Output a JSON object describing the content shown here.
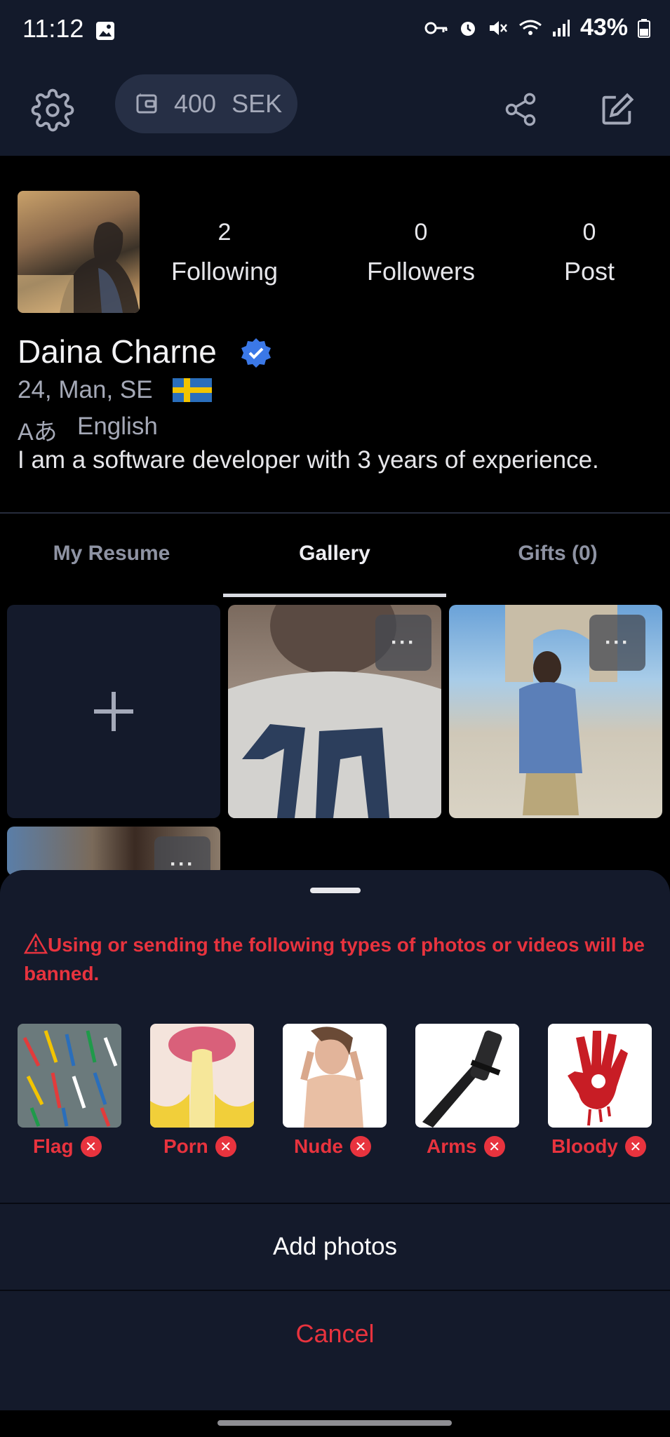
{
  "status": {
    "time": "11:12",
    "battery": "43%"
  },
  "wallet": {
    "amount": "400",
    "currency": "SEK"
  },
  "profile": {
    "name": "Daina Charne",
    "meta": "24, Man, SE",
    "language_icon": "Aあ",
    "language": "English",
    "bio": "I am a software developer with 3 years of experience."
  },
  "stats": [
    {
      "value": "2",
      "label": "Following"
    },
    {
      "value": "0",
      "label": "Followers"
    },
    {
      "value": "0",
      "label": "Post"
    }
  ],
  "tabs": [
    {
      "label": "My Resume",
      "active": false
    },
    {
      "label": "Gallery",
      "active": true
    },
    {
      "label": "Gifts (0)",
      "active": false
    }
  ],
  "gallery": {
    "add_icon": "plus-icon",
    "more_label": "···"
  },
  "sheet": {
    "warning": "Using or sending the following types of photos or videos will be banned.",
    "categories": [
      {
        "label": "Flag",
        "icon": "flags-image"
      },
      {
        "label": "Porn",
        "icon": "banana-image"
      },
      {
        "label": "Nude",
        "icon": "nude-image"
      },
      {
        "label": "Arms",
        "icon": "knife-image"
      },
      {
        "label": "Bloody",
        "icon": "bloody-hand-image"
      }
    ],
    "add_label": "Add photos",
    "cancel_label": "Cancel"
  },
  "colors": {
    "accent_red": "#e8333e",
    "header_bg": "#131a2b",
    "verified_blue": "#3b78e7"
  }
}
